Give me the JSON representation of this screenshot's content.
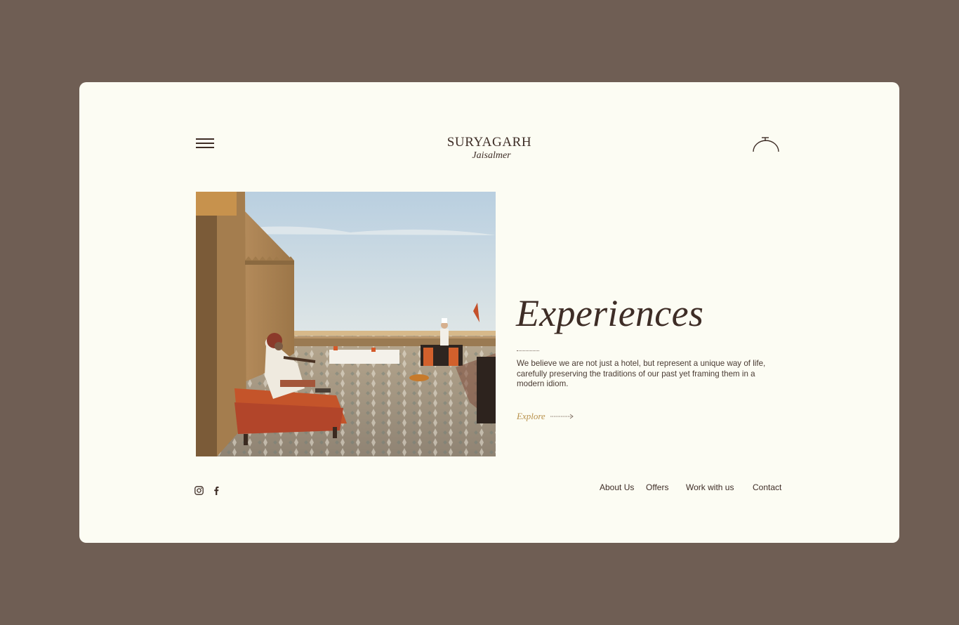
{
  "header": {
    "brand": "SURYAGARH",
    "brand_sub": "Jaisalmer",
    "menu_icon": "hamburger-menu-icon",
    "dining_icon": "cloche-icon"
  },
  "hero": {
    "image_alt": "Musician playing on a rooftop terrace with dining tables at sunset",
    "title": "Experiences",
    "description": "We believe we are not just a hotel, but represent a unique way of life, carefully preserving the traditions of our past yet framing them in a modern idiom.",
    "cta_label": "Explore"
  },
  "footer": {
    "social_icons": [
      "instagram-icon",
      "facebook-icon"
    ],
    "nav": [
      {
        "label": "About Us"
      },
      {
        "label": "Offers"
      },
      {
        "label": "Work with us"
      },
      {
        "label": "Contact"
      }
    ]
  },
  "colors": {
    "background": "#6f5e54",
    "card": "#fcfcf3",
    "text_dark": "#3e2d26",
    "accent_gold": "#b8914b"
  }
}
